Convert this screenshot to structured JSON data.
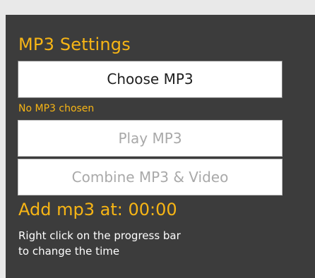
{
  "mp3_settings": {
    "title": "MP3 Settings",
    "choose_button": "Choose MP3",
    "status_text": "No MP3 chosen",
    "play_button": "Play MP3",
    "combine_button": "Combine MP3 & Video",
    "add_at_label": "Add mp3 at:",
    "add_at_time": "00:00",
    "hint_line1": "Right click on the progress bar",
    "hint_line2": "to change the time"
  },
  "colors": {
    "accent": "#f7b515",
    "panel_background": "#3c3c3c",
    "page_background": "#e9e9e9",
    "disabled_text": "#a9a9a9"
  }
}
